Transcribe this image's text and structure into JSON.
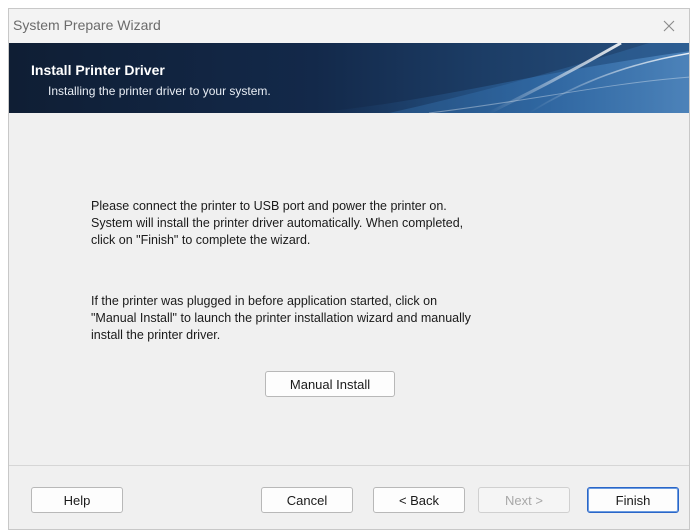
{
  "window": {
    "title": "System Prepare Wizard",
    "close_glyph": "✕"
  },
  "banner": {
    "title": "Install Printer Driver",
    "subtitle": "Installing the printer driver to your system."
  },
  "content": {
    "message1": "Please connect the printer to USB port and power the printer on.\nSystem will install the printer driver automatically. When completed,\nclick on \"Finish\" to complete the wizard.",
    "message2": "If the printer was plugged in before application started, click on\n\"Manual Install\" to launch the printer installation wizard and manually\ninstall the printer driver.",
    "manual_install_label": "Manual Install"
  },
  "footer": {
    "help_label": "Help",
    "cancel_label": "Cancel",
    "back_label": "< Back",
    "next_label": "Next >",
    "finish_label": "Finish",
    "next_enabled": false
  },
  "colors": {
    "banner_dark": "#0f1e34",
    "banner_light": "#27507f",
    "default_button_border": "#2a66c8"
  }
}
